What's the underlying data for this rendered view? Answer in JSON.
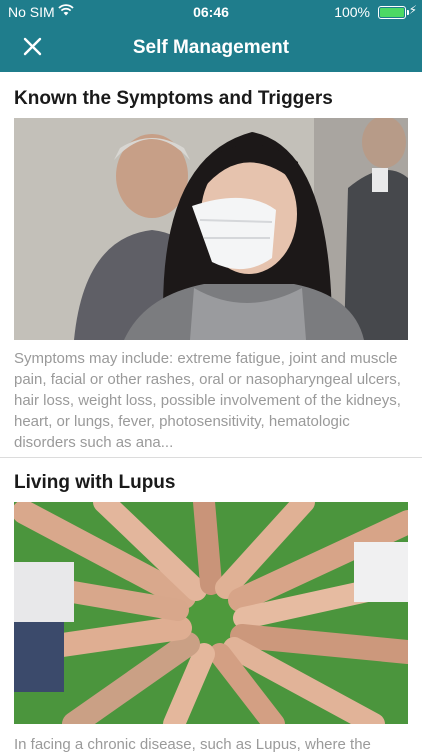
{
  "status_bar": {
    "carrier": "No SIM",
    "time": "06:46",
    "battery": "100%"
  },
  "nav": {
    "title": "Self Management"
  },
  "sections": [
    {
      "title": "Known the Symptoms and Triggers",
      "description": "Symptoms may include: extreme fatigue, joint and muscle pain, facial or other rashes, oral or nasopharyngeal ulcers, hair loss, weight loss, possible involvement of the kidneys, heart, or lungs, fever, photosensitivity, hematologic disorders such as ana..."
    },
    {
      "title": "Living with Lupus",
      "description": "In facing a chronic disease, such as Lupus, where the"
    }
  ],
  "colors": {
    "header": "#1f7d8c",
    "text": "#1a1a1a",
    "muted": "#9a9a9a"
  }
}
